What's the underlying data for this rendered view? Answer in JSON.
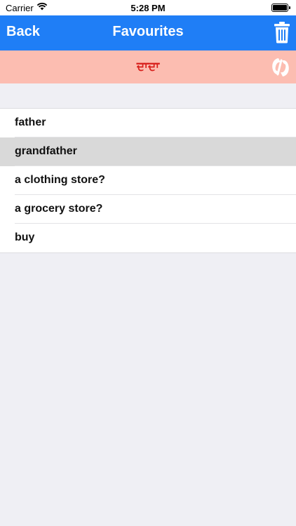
{
  "status": {
    "carrier": "Carrier",
    "time": "5:28 PM"
  },
  "nav": {
    "back_label": "Back",
    "title": "Favourites"
  },
  "translation": {
    "text": "ਦਾਦਾ"
  },
  "list": {
    "items": [
      {
        "label": "father",
        "selected": false
      },
      {
        "label": "grandfather",
        "selected": true
      },
      {
        "label": "a clothing store?",
        "selected": false
      },
      {
        "label": "a grocery store?",
        "selected": false
      },
      {
        "label": "buy",
        "selected": false
      }
    ]
  },
  "icons": {
    "wifi": "wifi-icon",
    "battery": "battery-icon",
    "trash": "trash-icon",
    "audio": "speak-icon"
  },
  "colors": {
    "nav_bg": "#1f7ef6",
    "translation_bg": "#fcbdb1",
    "translation_text": "#d8201c",
    "selected_row": "#d9d9d9",
    "background": "#efeff4"
  }
}
